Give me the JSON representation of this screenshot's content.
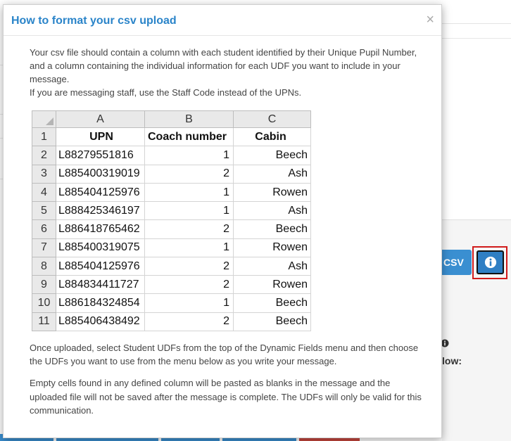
{
  "modal": {
    "title": "How to format your csv upload",
    "close_symbol": "×",
    "intro_line_1": "Your csv file should contain a column with each student identified by their Unique Pupil Number, and a column containing the individual information for each UDF you want to include in your message.",
    "intro_line_2": "If you are messaging staff, use the Staff Code instead of the UPNs.",
    "para_2": "Once uploaded, select Student UDFs from the top of the Dynamic Fields menu and then choose the UDFs you want to use from the menu below as you write your message.",
    "para_3": "Empty cells found in any defined column will be pasted as blanks in the message and the uploaded file will not be saved after the message is complete. The UDFs will only be valid for this communication."
  },
  "spreadsheet": {
    "column_letters": [
      "A",
      "B",
      "C"
    ],
    "header_row_number": "1",
    "headers": [
      "UPN",
      "Coach number",
      "Cabin"
    ],
    "rows": [
      {
        "num": "2",
        "upn": "L88279551816",
        "coach": "1",
        "cabin": "Beech"
      },
      {
        "num": "3",
        "upn": "L885400319019",
        "coach": "2",
        "cabin": "Ash"
      },
      {
        "num": "4",
        "upn": "L885404125976",
        "coach": "1",
        "cabin": "Rowen"
      },
      {
        "num": "5",
        "upn": "L888425346197",
        "coach": "1",
        "cabin": "Ash"
      },
      {
        "num": "6",
        "upn": "L886418765462",
        "coach": "2",
        "cabin": "Beech"
      },
      {
        "num": "7",
        "upn": "L885400319075",
        "coach": "1",
        "cabin": "Rowen"
      },
      {
        "num": "8",
        "upn": "L885404125976",
        "coach": "2",
        "cabin": "Ash"
      },
      {
        "num": "9",
        "upn": "L884834411727",
        "coach": "2",
        "cabin": "Rowen"
      },
      {
        "num": "10",
        "upn": "L886184324854",
        "coach": "1",
        "cabin": "Beech"
      },
      {
        "num": "11",
        "upn": "L885406438492",
        "coach": "2",
        "cabin": "Beech"
      }
    ]
  },
  "background": {
    "csv_button_label": "CSV",
    "info_button_icon": "info-circle-icon",
    "partial_text_low": "low:"
  },
  "colors": {
    "title_blue": "#2a84c9",
    "button_blue": "#3a8fd1",
    "highlight_red": "#d11b1b"
  }
}
